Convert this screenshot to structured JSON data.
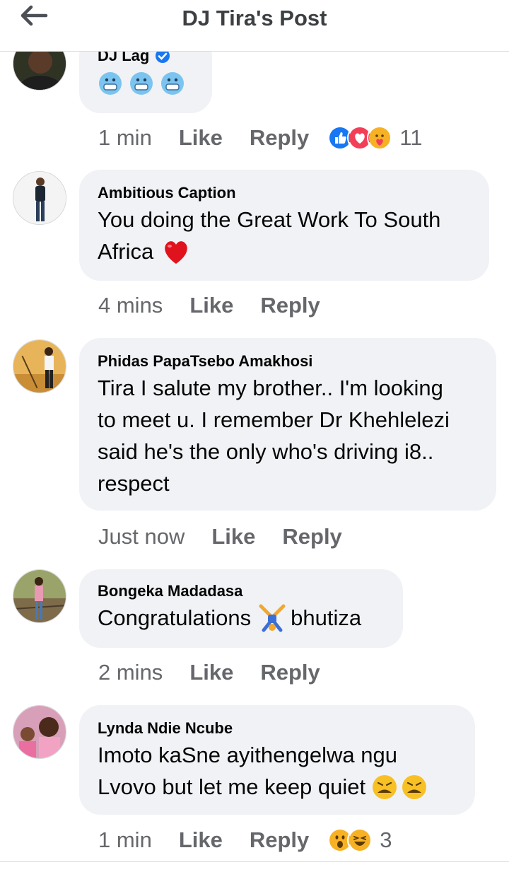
{
  "header": {
    "title": "DJ Tira's Post"
  },
  "comments": [
    {
      "author": "DJ Lag",
      "text": "",
      "emojis": [
        "cold-face",
        "cold-face",
        "cold-face"
      ],
      "time": "1 min",
      "like": "Like",
      "reply": "Reply",
      "reaction_count": "11"
    },
    {
      "author": "Ambitious Caption",
      "line1": "You doing the Great Work To South",
      "line2": "Africa",
      "time": "4 mins",
      "like": "Like",
      "reply": "Reply"
    },
    {
      "author": "Phidas PapaTsebo Amakhosi",
      "line1": "Tira I salute my brother.. I'm looking",
      "line2": "to meet u. I remember Dr Khehlelezi",
      "line3": "said he's the only who's driving i8..",
      "line4": "respect",
      "time": "Just now",
      "like": "Like",
      "reply": "Reply"
    },
    {
      "author": "Bongeka Madadasa",
      "before": "Congratulations",
      "after": "bhutiza",
      "time": "2 mins",
      "like": "Like",
      "reply": "Reply"
    },
    {
      "author": "Lynda Ndie Ncube",
      "line1": "Imoto kaSne ayithengelwa ngu",
      "line2": "Lvovo but let me keep quiet",
      "time": "1 min",
      "like": "Like",
      "reply": "Reply",
      "reaction_count": "3"
    }
  ],
  "colors": {
    "like_blue": "#1877f2",
    "love_red": "#f33e58",
    "care_yellow": "#f7b125",
    "bubble": "#f0f2f5",
    "meta": "#65676b"
  }
}
